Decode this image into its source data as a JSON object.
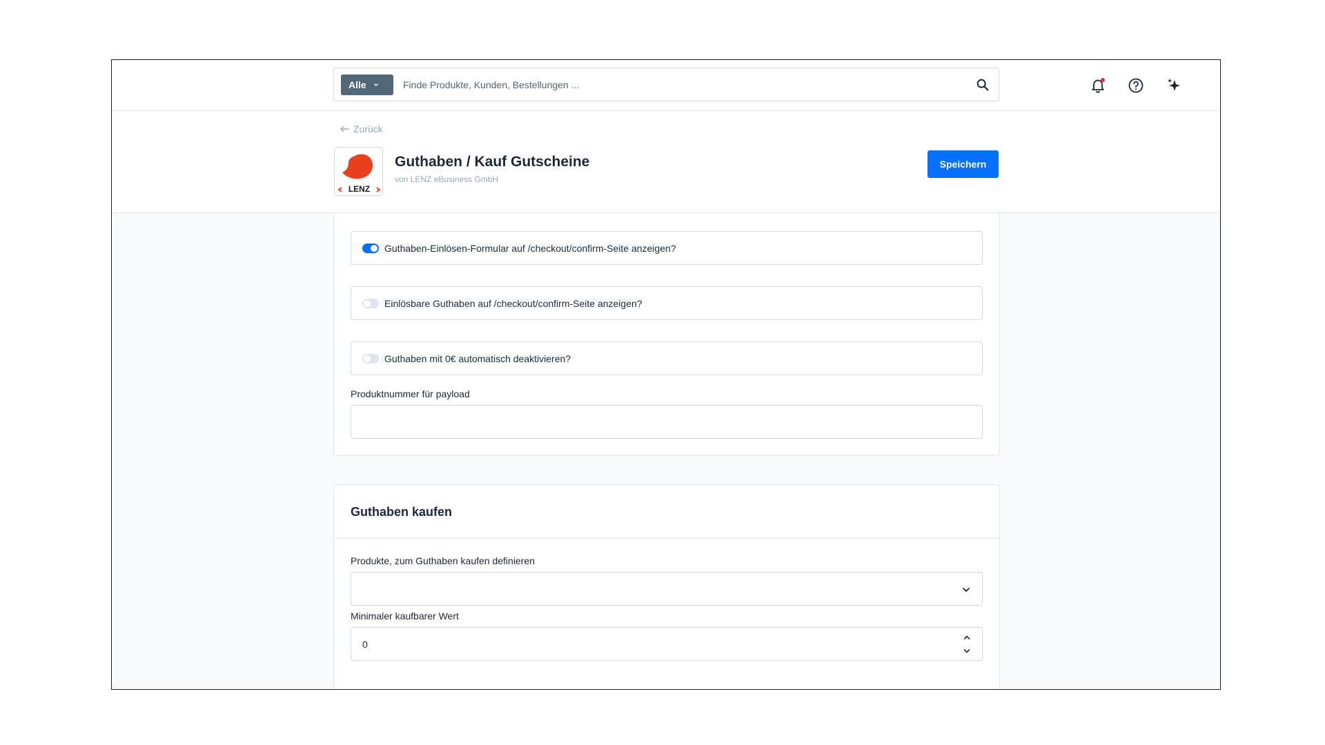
{
  "search": {
    "type_label": "Alle",
    "placeholder": "Finde Produkte, Kunden, Bestellungen ..."
  },
  "header": {
    "back_label": "Zurück",
    "logo_text": "LENZ",
    "title": "Guthaben / Kauf Gutscheine",
    "vendor": "von LENZ eBusiness GmbH",
    "save_label": "Speichern"
  },
  "settings": {
    "switches": [
      {
        "label": "Guthaben-Einlösen-Formular auf /checkout/confirm-Seite anzeigen?",
        "checked": true
      },
      {
        "label": "Einlösbare Guthaben auf /checkout/confirm-Seite anzeigen?",
        "checked": false
      },
      {
        "label": "Guthaben mit 0€ automatisch deaktivieren?",
        "checked": false
      }
    ],
    "product_number_label": "Produktnummer für payload",
    "product_number_value": ""
  },
  "buy_credit": {
    "title": "Guthaben kaufen",
    "products_label": "Produkte, zum Guthaben kaufen definieren",
    "products_value": "",
    "min_value_label": "Minimaler kaufbarer Wert",
    "min_value": "0"
  },
  "colors": {
    "primary": "#0870ff",
    "logo_red": "#e8401c",
    "notification_dot": "#de294c"
  },
  "icons": [
    "chevron-down-icon",
    "search-icon",
    "bell-icon",
    "help-icon",
    "sparkles-icon",
    "arrow-left-icon"
  ]
}
